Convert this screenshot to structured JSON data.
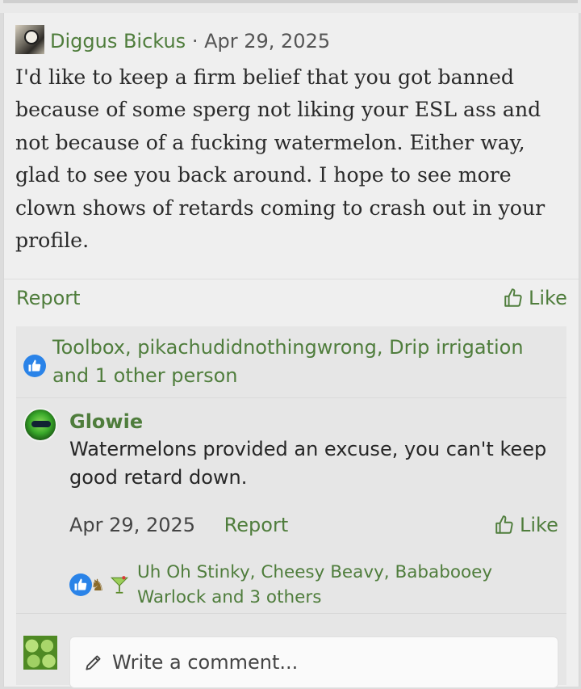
{
  "post": {
    "author": "Diggus Bickus",
    "separator": "·",
    "date": "Apr 29, 2025",
    "body": "I'd like to keep a firm belief that you got banned because of some sperg not liking your ESL ass and not because of a fucking watermelon. Either way, glad to see you back around. I hope to see more clown shows of retards coming to crash out in your profile.",
    "report_label": "Report",
    "like_label": "Like",
    "reactions_text": "Toolbox, pikachudidnothingwrong, Drip irrigation and 1 other person"
  },
  "comment": {
    "author": "Glowie",
    "text": "Watermelons provided an excuse, you can't keep good retard down.",
    "date": "Apr 29, 2025",
    "report_label": "Report",
    "like_label": "Like",
    "reactions_text": "Uh Oh Stinky, Cheesy Beavy, Bababooey Warlock and 3 others"
  },
  "composer": {
    "placeholder": "Write a comment..."
  },
  "icons": {
    "like": "thumbs-up-icon",
    "reaction": "thumbs-up-reaction-icon",
    "mascot": "mascot-reaction-icon",
    "cocktail": "cocktail-reaction-icon",
    "pencil": "pencil-icon"
  },
  "colors": {
    "link_green": "#4f7d3c",
    "reaction_blue": "#2a83e8"
  }
}
